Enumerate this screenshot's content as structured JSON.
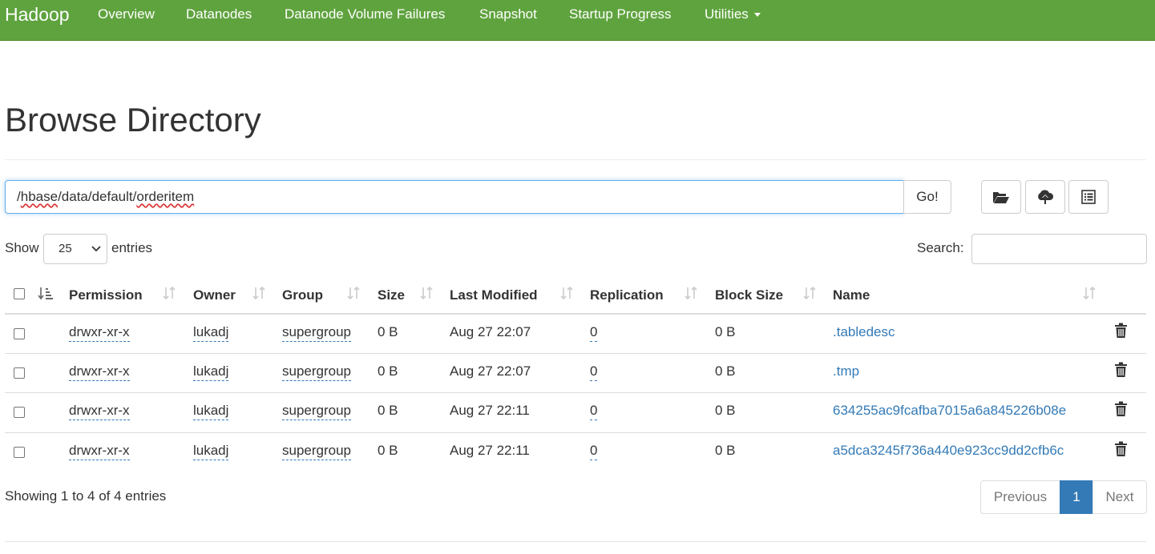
{
  "navbar": {
    "brand": "Hadoop",
    "items": [
      "Overview",
      "Datanodes",
      "Datanode Volume Failures",
      "Snapshot",
      "Startup Progress",
      "Utilities"
    ],
    "color": "#5fa33e"
  },
  "page": {
    "title": "Browse Directory"
  },
  "path": {
    "value": "/hbase/data/default/orderitem",
    "go_label": "Go!"
  },
  "toolbar": {
    "icons": [
      "folder-open-icon",
      "upload-icon",
      "list-icon"
    ]
  },
  "controls": {
    "show_label": "Show",
    "page_length": "25",
    "entries_label": "entries",
    "search_label": "Search:"
  },
  "table": {
    "headers": [
      "Permission",
      "Owner",
      "Group",
      "Size",
      "Last Modified",
      "Replication",
      "Block Size",
      "Name"
    ],
    "rows": [
      {
        "permission": "drwxr-xr-x",
        "owner": "lukadj",
        "group": "supergroup",
        "size": "0 B",
        "modified": "Aug 27 22:07",
        "replication": "0",
        "block_size": "0 B",
        "name": ".tabledesc"
      },
      {
        "permission": "drwxr-xr-x",
        "owner": "lukadj",
        "group": "supergroup",
        "size": "0 B",
        "modified": "Aug 27 22:07",
        "replication": "0",
        "block_size": "0 B",
        "name": ".tmp"
      },
      {
        "permission": "drwxr-xr-x",
        "owner": "lukadj",
        "group": "supergroup",
        "size": "0 B",
        "modified": "Aug 27 22:11",
        "replication": "0",
        "block_size": "0 B",
        "name": "634255ac9fcafba7015a6a845226b08e"
      },
      {
        "permission": "drwxr-xr-x",
        "owner": "lukadj",
        "group": "supergroup",
        "size": "0 B",
        "modified": "Aug 27 22:11",
        "replication": "0",
        "block_size": "0 B",
        "name": "a5dca3245f736a440e923cc9dd2cfb6c"
      }
    ]
  },
  "footer": {
    "info": "Showing 1 to 4 of 4 entries",
    "previous": "Previous",
    "current_page": "1",
    "next": "Next"
  }
}
